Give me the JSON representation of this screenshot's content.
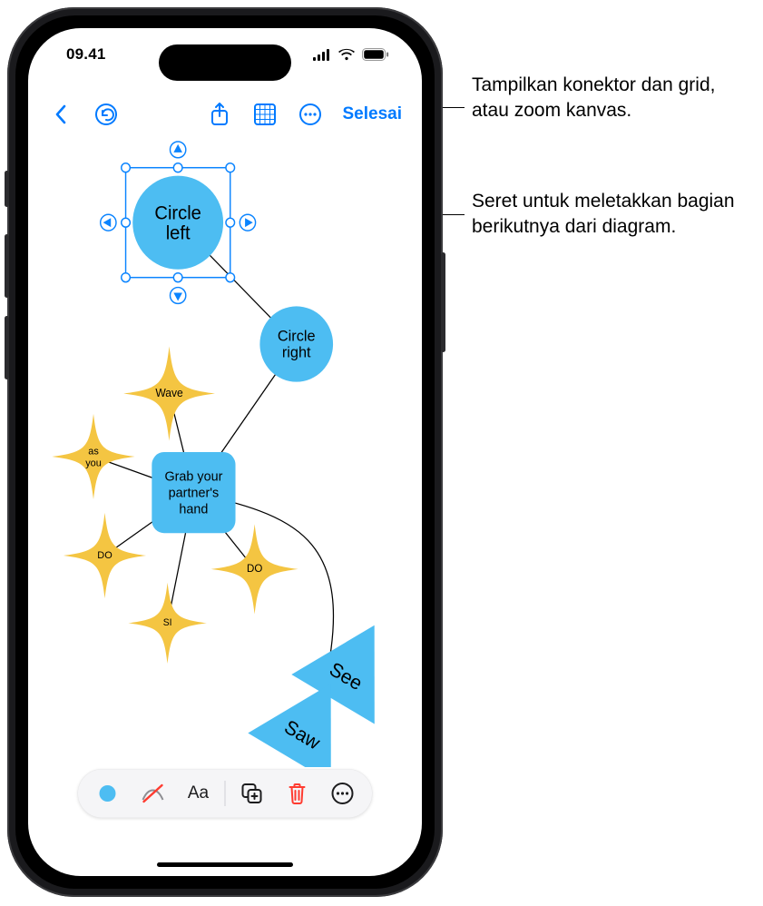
{
  "status": {
    "time": "09.41"
  },
  "toolbar": {
    "done_label": "Selesai"
  },
  "diagram": {
    "circle_left": "Circle\nleft",
    "circle_right": "Circle\nright",
    "square": "Grab your\npartner's\nhand",
    "stars": {
      "wave": "Wave",
      "as_you": "as\nyou",
      "do1": "DO",
      "si": "SI",
      "do2": "DO"
    },
    "triangles": {
      "see": "See",
      "saw": "Saw"
    }
  },
  "callouts": {
    "grid": "Tampilkan konektor dan grid, atau zoom kanvas.",
    "drag": "Seret untuk meletakkan bagian berikutnya dari diagram."
  }
}
